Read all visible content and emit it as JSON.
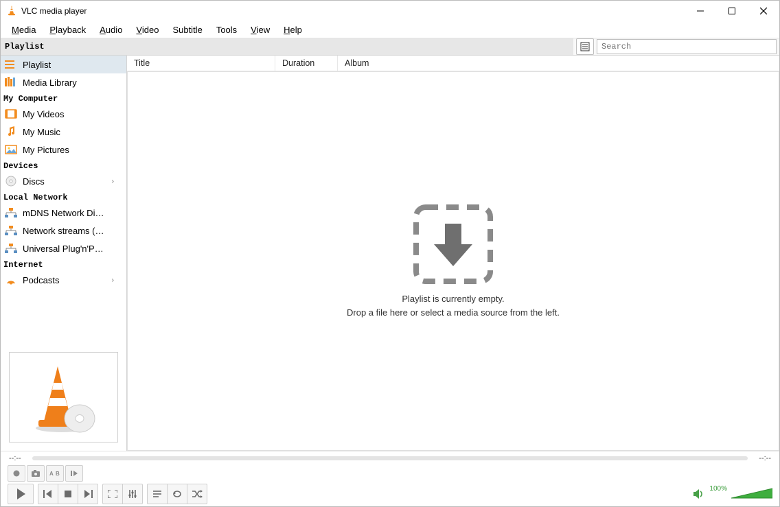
{
  "window": {
    "title": "VLC media player"
  },
  "menu": {
    "media": {
      "u": "M",
      "rest": "edia"
    },
    "playback": {
      "u": "P",
      "rest": "layback"
    },
    "audio": {
      "u": "A",
      "rest": "udio"
    },
    "video": {
      "u": "V",
      "rest": "ideo"
    },
    "subtitle": {
      "u": "",
      "rest": "Subtitle"
    },
    "tools": {
      "u": "",
      "rest": "Tools"
    },
    "view": {
      "u": "V",
      "rest": "iew"
    },
    "help": {
      "u": "H",
      "rest": "elp"
    }
  },
  "header": {
    "playlist_label": "Playlist",
    "search_placeholder": "Search"
  },
  "sidebar": {
    "playlist": "Playlist",
    "media_library": "Media Library",
    "group_my_computer": "My Computer",
    "my_videos": "My Videos",
    "my_music": "My Music",
    "my_pictures": "My Pictures",
    "group_devices": "Devices",
    "discs": "Discs",
    "group_local_network": "Local Network",
    "mdns": "mDNS Network Disco…",
    "sap": "Network streams (SAP)",
    "upnp": "Universal Plug'n'Play",
    "group_internet": "Internet",
    "podcasts": "Podcasts"
  },
  "columns": {
    "title": "Title",
    "duration": "Duration",
    "album": "Album"
  },
  "empty": {
    "line1": "Playlist is currently empty.",
    "line2": "Drop a file here or select a media source from the left."
  },
  "seek": {
    "left": "--:--",
    "right": "--:--"
  },
  "volume": {
    "percent": "100%"
  }
}
